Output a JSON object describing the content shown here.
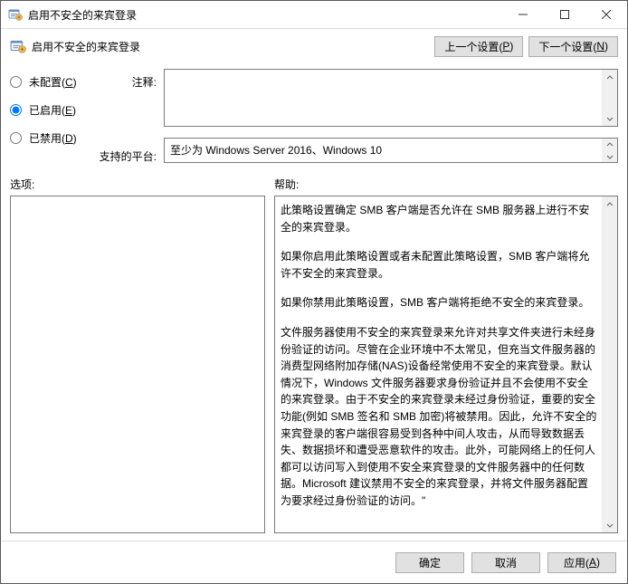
{
  "title": "启用不安全的来宾登录",
  "subtitle": "启用不安全的来宾登录",
  "nav": {
    "prev_prefix": "上一个设置(",
    "prev_m": "P",
    "prev_suffix": ")",
    "next_prefix": "下一个设置(",
    "next_m": "N",
    "next_suffix": ")"
  },
  "radios": {
    "not_configured_prefix": "未配置(",
    "not_configured_m": "C",
    "not_configured_suffix": ")",
    "enabled_prefix": "已启用(",
    "enabled_m": "E",
    "enabled_suffix": ")",
    "disabled_prefix": "已禁用(",
    "disabled_m": "D",
    "disabled_suffix": ")",
    "selected": "enabled"
  },
  "labels": {
    "comment": "注释:",
    "platform": "支持的平台:",
    "options": "选项:",
    "help": "帮助:"
  },
  "platform_text": "至少为 Windows Server 2016、Windows 10",
  "help": {
    "p1": "此策略设置确定 SMB 客户端是否允许在 SMB 服务器上进行不安全的来宾登录。",
    "p2": "如果你启用此策略设置或者未配置此策略设置，SMB 客户端将允许不安全的来宾登录。",
    "p3": "如果你禁用此策略设置，SMB 客户端将拒绝不安全的来宾登录。",
    "p4": "文件服务器使用不安全的来宾登录来允许对共享文件夹进行未经身份验证的访问。尽管在企业环境中不太常见，但充当文件服务器的消费型网络附加存储(NAS)设备经常使用不安全的来宾登录。默认情况下，Windows 文件服务器要求身份验证并且不会使用不安全的来宾登录。由于不安全的来宾登录未经过身份验证，重要的安全功能(例如 SMB 签名和 SMB 加密)将被禁用。因此，允许不安全的来宾登录的客户端很容易受到各种中间人攻击，从而导致数据丢失、数据损坏和遭受恶意软件的攻击。此外，可能网络上的任何人都可以访问写入到使用不安全来宾登录的文件服务器中的任何数据。Microsoft 建议禁用不安全的来宾登录，并将文件服务器配置为要求经过身份验证的访问。\""
  },
  "footer": {
    "ok": "确定",
    "cancel": "取消",
    "apply_prefix": "应用(",
    "apply_m": "A",
    "apply_suffix": ")"
  }
}
